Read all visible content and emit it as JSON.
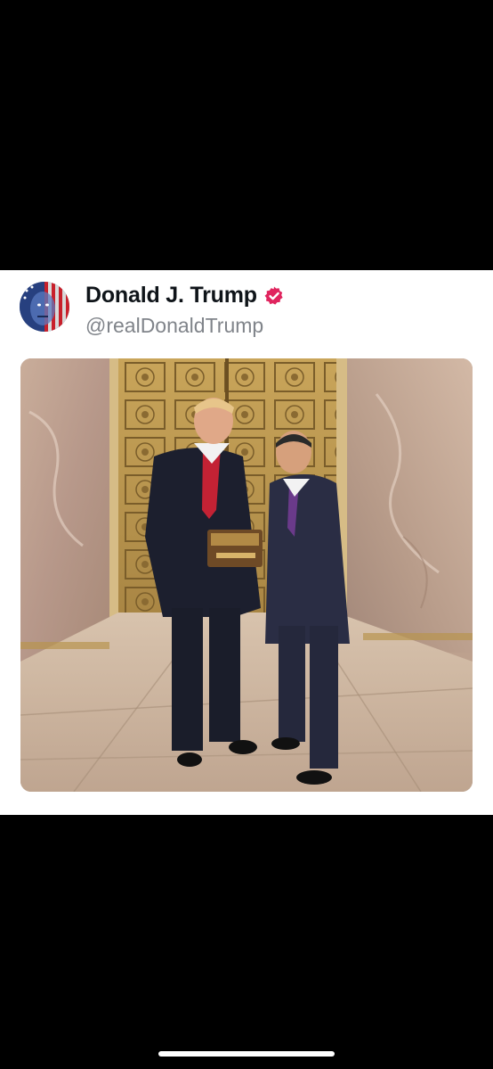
{
  "post": {
    "display_name": "Donald J. Trump",
    "handle": "@realDonaldTrump",
    "verified": true,
    "verified_badge_color": "#e0245e"
  },
  "icons": {
    "verified": "verified-badge-icon",
    "avatar": "profile-avatar-image"
  },
  "photo": {
    "subject": "Two men in suits holding a ceremonial key box in front of an ornate gold elevator door with marble walls"
  }
}
